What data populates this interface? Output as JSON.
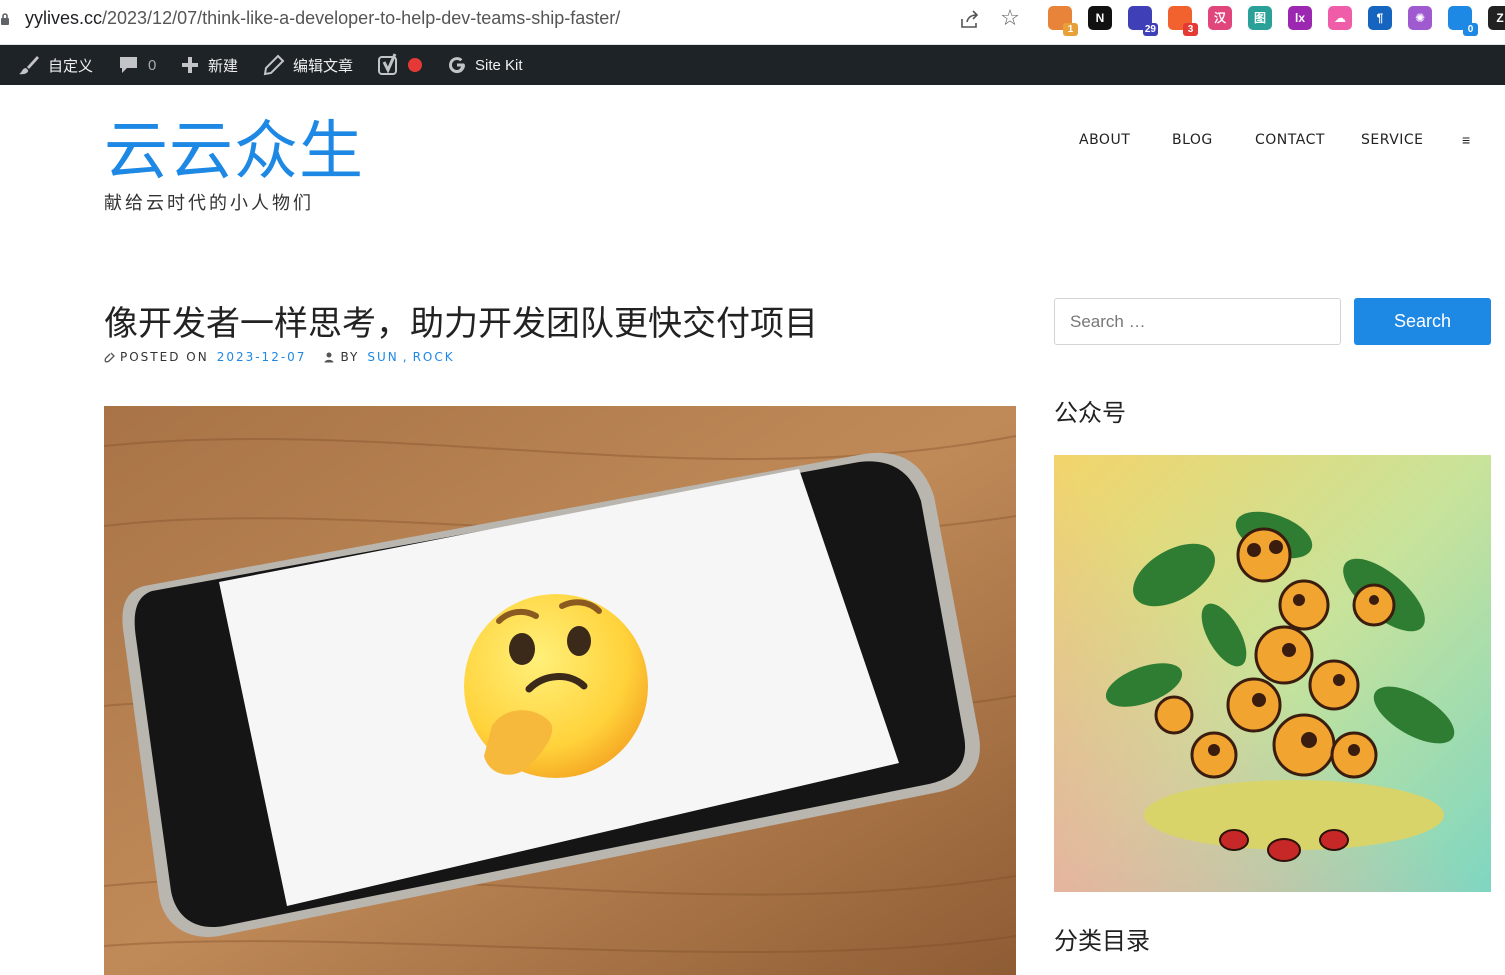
{
  "browser": {
    "url_host": "yylives.cc",
    "url_path": "/2023/12/07/think-like-a-developer-to-help-dev-teams-ship-faster/",
    "extensions": [
      {
        "name": "ext-1-icon",
        "badge": "1",
        "color": "#e8843a",
        "badge_color": "#e8a13a"
      },
      {
        "name": "notion-icon",
        "badge": "",
        "color": "#111111",
        "glyph": "N"
      },
      {
        "name": "ext-graduation-icon",
        "badge": "29",
        "color": "#3f3fb8",
        "badge_color": "#3f3fb8"
      },
      {
        "name": "ext-4-icon",
        "badge": "3",
        "color": "#f2622e",
        "badge_color": "#e53935"
      },
      {
        "name": "ext-5-icon",
        "badge": "",
        "color": "#e0457b",
        "glyph": "汉"
      },
      {
        "name": "ext-6-icon",
        "badge": "",
        "color": "#2aa198",
        "glyph": "图"
      },
      {
        "name": "ext-7-icon",
        "badge": "",
        "color": "#9c27b0",
        "glyph": "lx"
      },
      {
        "name": "ext-8-icon",
        "badge": "",
        "color": "#ef5da8",
        "glyph": "☁"
      },
      {
        "name": "ext-9-icon",
        "badge": "",
        "color": "#1565c0",
        "glyph": "¶"
      },
      {
        "name": "openai-icon",
        "badge": "",
        "color": "#a05ad0",
        "glyph": "✺"
      },
      {
        "name": "ext-11-icon",
        "badge": "0",
        "color": "#1e88e5",
        "badge_color": "#1e88e5"
      },
      {
        "name": "ext-12-icon",
        "badge": "",
        "color": "#222222",
        "glyph": "Z"
      }
    ]
  },
  "admin_bar": {
    "customize": "自定义",
    "comments_count": "0",
    "new": "新建",
    "edit_post": "编辑文章",
    "site_kit": "Site Kit"
  },
  "header": {
    "site_title": "云云众生",
    "tagline": "献给云时代的小人物们",
    "nav": [
      "ABOUT",
      "BLOG",
      "CONTACT",
      "SERVICE"
    ],
    "menu_glyph": "≡"
  },
  "post": {
    "title": "像开发者一样思考，助力开发团队更快交付项目",
    "posted_on_label": "POSTED ON",
    "date": "2023-12-07",
    "by_label": "BY",
    "author_1": "SUN",
    "author_sep": ", ",
    "author_2": "ROCK"
  },
  "sidebar": {
    "search_placeholder": "Search …",
    "search_button": "Search",
    "widget_1_title": "公众号",
    "widget_2_title": "分类目录"
  },
  "colors": {
    "accent": "#1e88e5",
    "admin_bar": "#1d2327"
  }
}
